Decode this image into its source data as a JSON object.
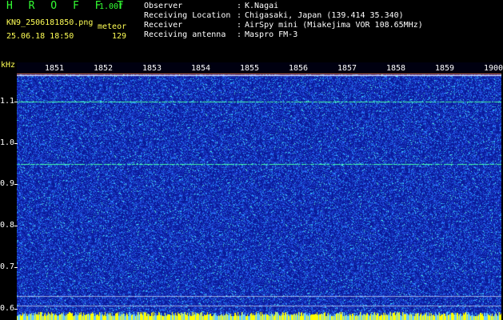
{
  "header": {
    "brand": "H R O F F T",
    "version": "1.00f",
    "filename": "KN9_2506181850.png",
    "datetime": "25.06.18 18:50",
    "mode": "meteor",
    "count": "129"
  },
  "info": [
    {
      "label": "Observer",
      "colon": ":",
      "value": "K.Nagai"
    },
    {
      "label": "Receiving Location",
      "colon": ":",
      "value": "Chigasaki, Japan (139.414 35.340)"
    },
    {
      "label": "Receiver",
      "colon": ":",
      "value": "AirSpy mini (Miakejima VOR 108.65MHz)"
    },
    {
      "label": "Receiving antenna",
      "colon": ":",
      "value": "Maspro FM-3"
    }
  ],
  "plot": {
    "unit": "kHz",
    "time_labels": [
      "1851",
      "1852",
      "1853",
      "1854",
      "1855",
      "1856",
      "1857",
      "1858",
      "1859",
      "1900"
    ],
    "freq_labels": [
      "1.1",
      "1.0",
      "0.9",
      "0.8",
      "0.7",
      "0.6"
    ],
    "freq_range": [
      0.58,
      1.16
    ],
    "signal_lines_khz": [
      1.1,
      0.95
    ],
    "colors": {
      "background": "#0a1a9a",
      "noise_mid": "#2a6bff",
      "noise_high": "#44ffee",
      "signal": "#44ffaa",
      "baseline": "#ffff00"
    }
  }
}
